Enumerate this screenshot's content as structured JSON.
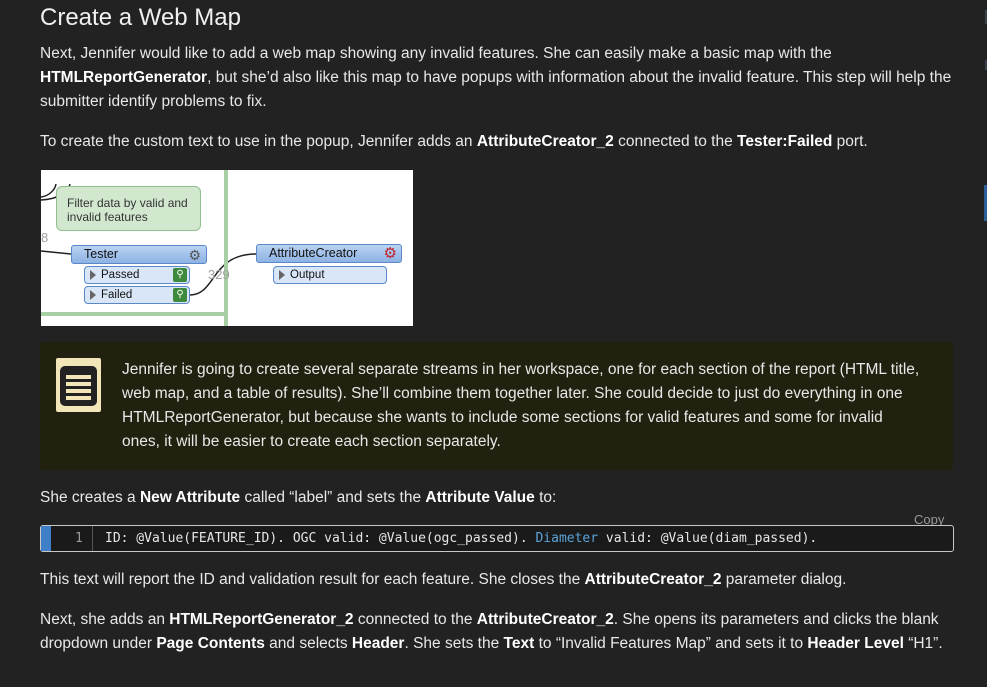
{
  "heading": "Create a Web Map",
  "p1": {
    "a": "Next, Jennifer would like to add a web map showing any invalid features. She can easily make a basic map with the ",
    "b1": "HTMLReportGenerator",
    "c": ", but she’d also like this map to have popups with information about the invalid feature. This step will help the submitter identify problems to fix."
  },
  "p2": {
    "a": "To create the custom text to use in the popup, Jennifer adds an ",
    "b1": "AttributeCreator_2",
    "c": " connected to the ",
    "b2": "Tester:Failed",
    "d": " port."
  },
  "diagram": {
    "note_text": "Filter data by valid and invalid features",
    "tester_label": "Tester",
    "passed_label": "Passed",
    "failed_label": "Failed",
    "attr_label": "AttributeCreator",
    "output_label": "Output",
    "count_left": "8",
    "count_passed": "329"
  },
  "tip": {
    "icon": "tip-list-icon",
    "text": "Jennifer is going to create several separate streams in her workspace, one for each section of the report (HTML title, web map, and a table of results). She’ll combine them together later. She could decide to just do everything in one HTMLReportGenerator, but because she wants to include some sections for valid features and some for invalid ones, it will be easier to create each section separately."
  },
  "p3": {
    "a": "She creates a ",
    "b1": "New Attribute",
    "c": " called “label” and sets the ",
    "b2": "Attribute Value",
    "d": " to:"
  },
  "code": {
    "copy_label": "Copy",
    "line_number": "1",
    "seg1": "ID: @Value(FEATURE_ID). OGC valid: @Value(ogc_passed). ",
    "seg2": "Diameter",
    "seg3": " valid: @Value(diam_passed)."
  },
  "p4": {
    "a": "This text will report the ID and validation result for each feature. She closes the ",
    "b1": "AttributeCreator_2",
    "c": " parameter dialog."
  },
  "p5": {
    "a": "Next, she adds an ",
    "b1": "HTMLReportGenerator_2",
    "c": " connected to the ",
    "b2": "AttributeCreator_2",
    "d": ". She opens its parameters and clicks the blank dropdown under ",
    "b3": "Page Contents",
    "e": " and selects ",
    "b4": "Header",
    "f": ". She sets the ",
    "b5": "Text",
    "g": " to “Invalid Features Map” and sets it to ",
    "b6": "Header Level",
    "h": " “H1”."
  },
  "colors": {
    "background": "#222222",
    "tip_background": "#22210f",
    "code_accent": "#3f7fc7",
    "transformer_blue": "#8db2e4",
    "note_green": "#d1e8cf"
  }
}
